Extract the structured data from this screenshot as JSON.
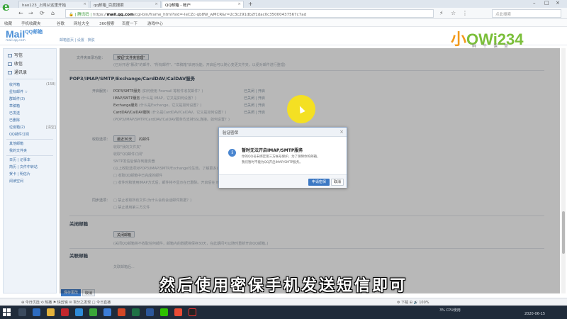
{
  "browser": {
    "tabs": [
      {
        "label": "hao123_上网从这里开始"
      },
      {
        "label": "qq邮箱_百度搜索"
      },
      {
        "label": "QQ邮箱 - 帐户",
        "active": true
      }
    ],
    "new_tab": "+",
    "url": {
      "prefix": "🔒 | 腾讯码 | ",
      "scheme": "https://",
      "domain": "mail.qq.com",
      "path": "/cgi-bin/frame_html?sid=-leCZc-qb8W_wMCR&r=2c3c291db2f1dac0c35000437567c7ad"
    },
    "search_placeholder": "点此搜索",
    "favorites": [
      "收藏",
      "手机收藏夹",
      "谷歌",
      "网址大全",
      "360搜索",
      "百度一下",
      "游戏中心"
    ]
  },
  "mail": {
    "logo": "Mail",
    "logo_qq": "QQ邮箱",
    "logo_sub": "mail.qq.com",
    "header_links": "邮箱首页 | 设置 · 换肤"
  },
  "brand": {
    "name_a": "小",
    "name_b": "OWi234",
    "sub": "鲜牛课堂"
  },
  "sidebar": {
    "buttons": [
      {
        "label": "写信"
      },
      {
        "label": "收信"
      },
      {
        "label": "通讯录"
      }
    ],
    "folders": [
      {
        "label": "收件箱",
        "count": "(158)"
      },
      {
        "label": "星标邮件 ☆",
        "count": ""
      },
      {
        "label": "群邮件(3)",
        "count": ""
      },
      {
        "label": "草稿箱",
        "count": ""
      },
      {
        "label": "已发送",
        "count": ""
      },
      {
        "label": "已删除",
        "count": ""
      },
      {
        "label": "垃圾箱(2)",
        "count": "[清空]"
      },
      {
        "label": "QQ邮件订阅",
        "count": ""
      },
      {
        "label": "其他邮箱",
        "count": ""
      },
      {
        "label": "我的文件夹",
        "count": ""
      },
      {
        "label": "日历 | 记事本",
        "count": ""
      },
      {
        "label": "简历 | 文件中转站",
        "count": ""
      },
      {
        "label": "贺卡 | 明信片",
        "count": ""
      },
      {
        "label": "阅读空间",
        "count": ""
      }
    ]
  },
  "settings": {
    "attach_label": "文件夹目录功能：",
    "attach_btn": "按钮\"文件夹管理\"",
    "attach_hint": "(已对开通\"篡改\"的邮件、\"所有邮件\"、\"草稿箱\"启用功能，开启后可以随心变更文件夹，以便对邮件进行整理)",
    "pop_section": "POP3/IMAP/SMTP/Exchange/CardDAV/CalDAV服务",
    "open_services": "开启服务：",
    "services": [
      {
        "name": "POP3/SMTP服务",
        "desc": "(如何使用 Foxmail 等软件收发邮件？)",
        "state": "已关闭",
        "action": "开启"
      },
      {
        "name": "IMAP/SMTP服务",
        "desc": "(什么是 IMAP，它又是如何设置？)",
        "state": "已关闭",
        "action": "开启"
      },
      {
        "name": "Exchange服务",
        "desc": "(什么是Exchange，它又是如何设置？)",
        "state": "已关闭",
        "action": "开启"
      },
      {
        "name": "CardDAV/CalDAV服务",
        "desc": "(什么是CardDAV/CalDAV，它又是如何设置？)",
        "state": "已关闭",
        "action": "开启"
      }
    ],
    "services_note": "(POP3/IMAP/SMTP/CardDAV/CalDAV服务均支持SSL连接。如何设置？)",
    "recv_label": "收取选项：",
    "recv_select": "最近30天",
    "recv_tail": "的邮件",
    "recv_options": [
      "收取\"我的文件夹\"",
      "收取\"QQ邮件订阅\"",
      "SMTP发信后保存到服务器"
    ],
    "recv_note": "(以上收取选项对POP3/IMAP/SMTP/Exchange均生效。了解更多)",
    "recv_note2": "□ 收取QQ邮箱中已完成的邮件",
    "recv_protect": "□ 收件时和使用IMAP方式后，邮件将不显示在已删除。开启后在 IMAP/Exchange协议中，显示",
    "sync_label": "同步选项：",
    "sync_opts": [
      "□ 禁止收取所有文件(为什么会有会话邮件数据？)",
      "□ 禁止通用第三方文件"
    ],
    "close_section": "关闭邮箱",
    "close_btn": "关闭邮箱",
    "close_note": "(关闭QQ邮箱将不收取任何邮件，邮箱内的数据将保存30天，在此期间可以随时重新开启QQ邮箱。)",
    "account_section": "关联邮箱",
    "account_row": "关联邮箱后...",
    "save_btn": "保存更改",
    "cancel_btn": "取消"
  },
  "dialog": {
    "title": "验证密保",
    "close": "×",
    "icon": "i",
    "heading": "暂时无法开启IMAP/SMTP服务",
    "body_line1": "你的QQ号未绑定第三方帐号保护，为了保障你的邮箱，",
    "body_line2": "我们暂时不能为QQ开启IMAP/SMTP服务。",
    "ok": "申请密保",
    "cancel": "取消"
  },
  "subtitle": "然后使用密保手机发送短信即可",
  "statusbar": {
    "left": "⊕ 今日优选  ⟲ 热播  ⚑ 快剪辑  ✉ 百分之发现  □ 今日直播",
    "right": "⚙ 下载 ⊞ 🔊 100%"
  },
  "taskbar": {
    "time": "2020-06-15",
    "cpu": "3%",
    "cpu_label": "CPU使用"
  }
}
